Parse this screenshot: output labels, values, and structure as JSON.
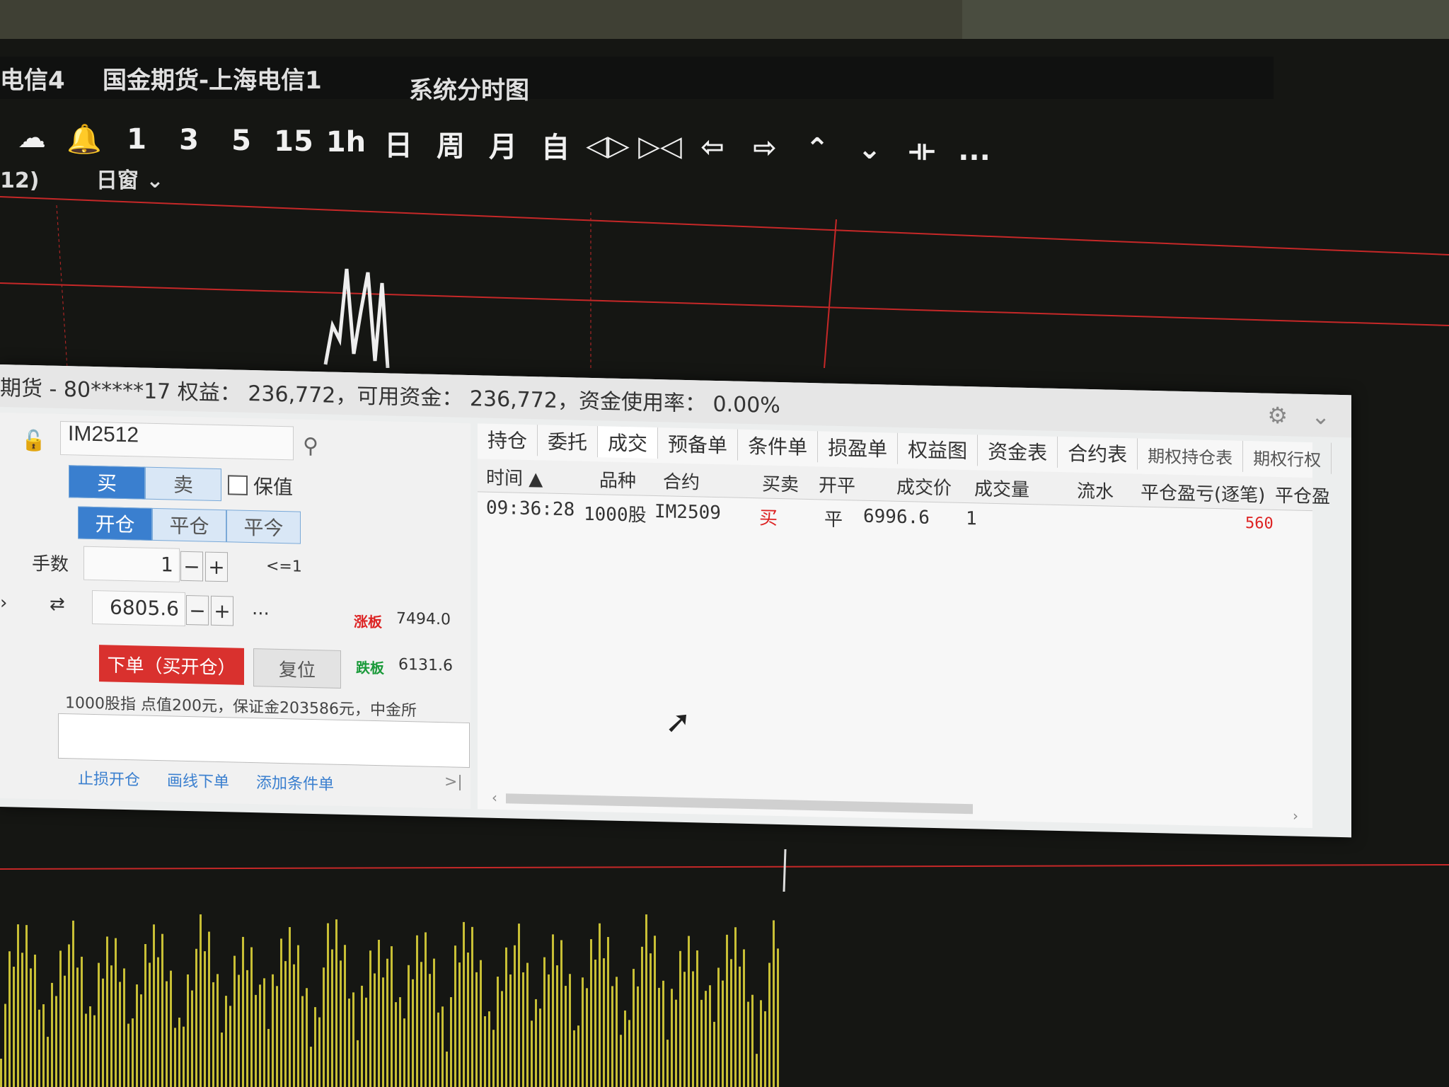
{
  "window": {
    "title_left": "电信4",
    "title_mid": "国金期货-上海电信1",
    "title_right": "系统分时图",
    "period_prefix": "12)",
    "window_select": "日窗"
  },
  "toolbar": [
    {
      "name": "cloud-sync-icon",
      "label": "☁"
    },
    {
      "name": "alert-bell-icon",
      "label": "🔔"
    },
    {
      "name": "period-1",
      "label": "1"
    },
    {
      "name": "period-3",
      "label": "3"
    },
    {
      "name": "period-5",
      "label": "5"
    },
    {
      "name": "period-15",
      "label": "15"
    },
    {
      "name": "period-1h",
      "label": "1h"
    },
    {
      "name": "period-day",
      "label": "日"
    },
    {
      "name": "period-week",
      "label": "周"
    },
    {
      "name": "period-month",
      "label": "月"
    },
    {
      "name": "period-custom",
      "label": "自"
    },
    {
      "name": "zoom-in-icon",
      "label": "◁▷"
    },
    {
      "name": "zoom-out-icon",
      "label": "▷◁"
    },
    {
      "name": "arrow-left-icon",
      "label": "⇦"
    },
    {
      "name": "arrow-right-icon",
      "label": "⇨"
    },
    {
      "name": "arrow-up-icon",
      "label": "⌃"
    },
    {
      "name": "arrow-down-icon",
      "label": "⌄"
    },
    {
      "name": "crosshair-icon",
      "label": "⟛"
    },
    {
      "name": "more-icon",
      "label": "..."
    }
  ],
  "account": {
    "header": "期货 - 80*****17  权益： 236,772，可用资金： 236,772，资金使用率： 0.00%"
  },
  "order": {
    "symbol": "IM2512",
    "buy_label": "买",
    "sell_label": "卖",
    "hedge_label": "保值",
    "open_label": "开仓",
    "close_label": "平仓",
    "close_today_label": "平今",
    "qty_label": "手数",
    "qty_value": "1",
    "qty_limit": "<=1",
    "price_value": "6805.6",
    "price_more": "...",
    "limit_up_label": "涨板",
    "limit_up_value": "7494.0",
    "limit_down_label": "跌板",
    "limit_down_value": "6131.6",
    "submit_label": "下单（买开仓）",
    "reset_label": "复位",
    "contract_info": "1000股指  点值200元，保证金203586元，中金所",
    "link_stop": "止损开仓",
    "link_draw": "画线下单",
    "link_condition": "添加条件单",
    "collapse": ">|"
  },
  "tabs": [
    "持仓",
    "委托",
    "成交",
    "预备单",
    "条件单",
    "损盈单",
    "权益图",
    "资金表",
    "合约表",
    "期权持仓表",
    "期权行权"
  ],
  "columns": [
    "时间 ▲",
    "品种",
    "合约",
    "买卖",
    "开平",
    "成交价",
    "成交量",
    "流水",
    "平仓盈亏(逐笔)",
    "平仓盈"
  ],
  "trades": [
    {
      "time": "09:36:28",
      "variety": "1000股",
      "contract": "IM2509",
      "side": "买",
      "offset": "平",
      "price": "6996.6",
      "volume": "1",
      "serial": "",
      "pnl": "560"
    }
  ],
  "colors": {
    "buy_active": "#3a7fcf",
    "submit": "#d9312e",
    "limit_up": "#dd2222",
    "limit_down": "#1a9a3a"
  }
}
